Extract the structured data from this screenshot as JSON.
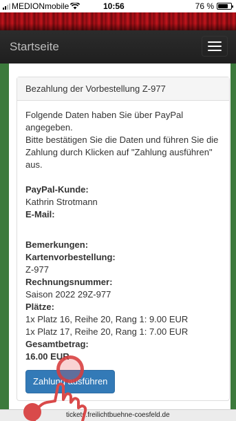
{
  "status_bar": {
    "carrier": "MEDIONmobile",
    "time": "10:56",
    "battery": "76 %",
    "battery_level": 0.76
  },
  "navbar": {
    "brand": "Startseite"
  },
  "panel": {
    "title": "Bezahlung der Vorbestellung Z-977",
    "intro_line1": "Folgende Daten haben Sie über PayPal angegeben.",
    "intro_line2": "Bitte bestätigen Sie die Daten und führen Sie die Zahlung durch Klicken auf \"Zahlung ausführen\" aus.",
    "paypal_label": "PayPal-Kunde:",
    "paypal_value": "Kathrin Strotmann",
    "email_label": "E-Mail:",
    "remarks_label": "Bemerkungen:",
    "order_label": "Kartenvorbestellung:",
    "order_value": "Z-977",
    "invoice_label": "Rechnungsnummer:",
    "invoice_value": "Saison 2022 29Z-977",
    "seats_label": "Plätze:",
    "seats": [
      "1x Platz 16, Reihe 20, Rang 1: 9.00 EUR",
      "1x Platz 17, Reihe 20, Rang 1: 7.00 EUR"
    ],
    "total_label": "Gesamtbetrag:",
    "total_value": "16.00 EUR",
    "pay_button": "Zahlung ausführen"
  },
  "url_bar": {
    "url": "tickets.freilichtbuehne-coesfeld.de"
  }
}
